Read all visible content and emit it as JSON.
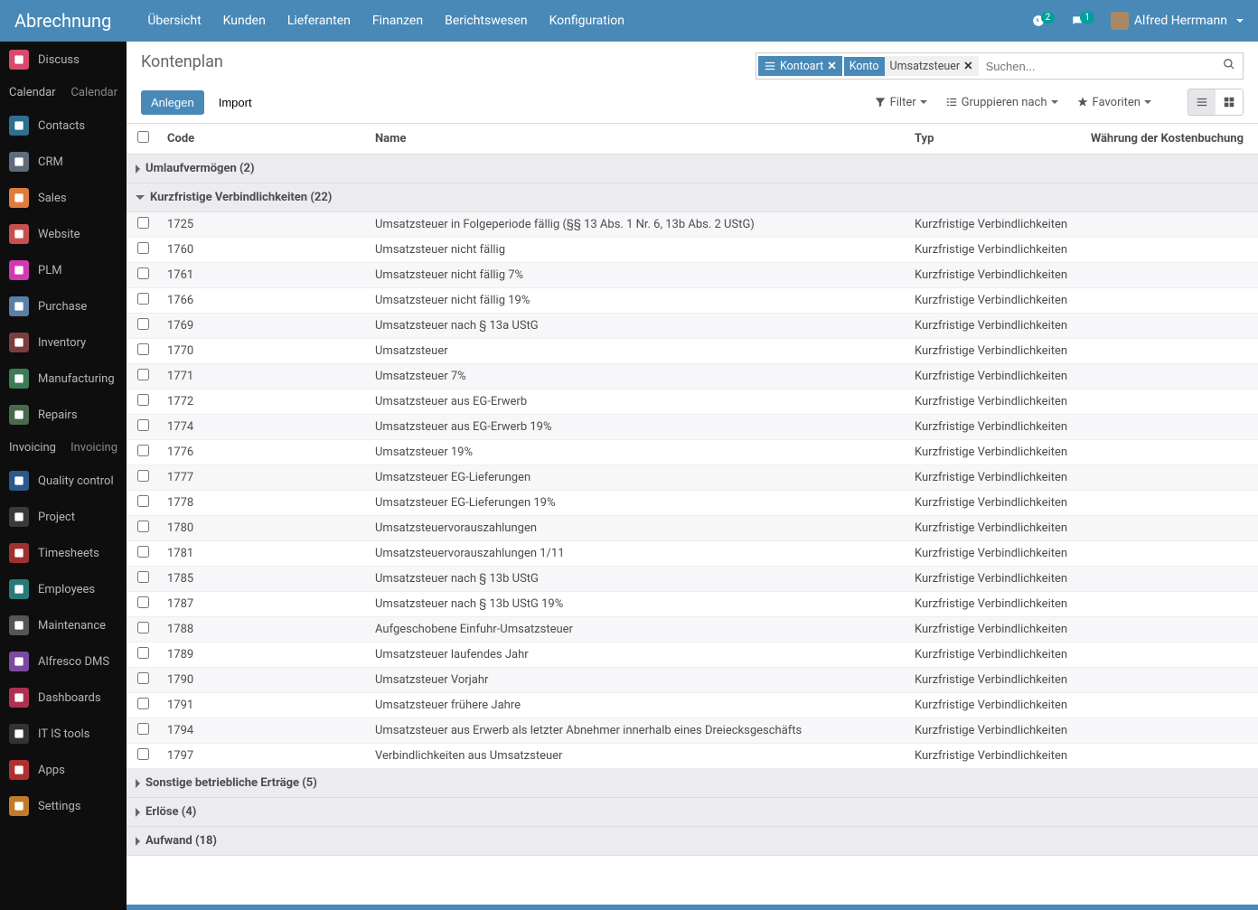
{
  "brand": "Abrechnung",
  "main_menu": [
    "Übersicht",
    "Kunden",
    "Lieferanten",
    "Finanzen",
    "Berichtswesen",
    "Konfiguration"
  ],
  "activity_badge": "2",
  "chat_badge": "1",
  "user_name": "Alfred Herrmann",
  "sidebar": [
    {
      "label": "Discuss",
      "bg": "#d84a6b",
      "icon": "chat"
    },
    {
      "label": "Calendar",
      "text2": "Calendar",
      "textonly": true
    },
    {
      "label": "Contacts",
      "bg": "#2f6f8f",
      "icon": "contacts"
    },
    {
      "label": "CRM",
      "bg": "#5e6b7a",
      "icon": "crm"
    },
    {
      "label": "Sales",
      "bg": "#e07b3c",
      "icon": "sales"
    },
    {
      "label": "Website",
      "bg": "#c94f4f",
      "icon": "globe"
    },
    {
      "label": "PLM",
      "bg": "#d13ab3",
      "icon": "plm"
    },
    {
      "label": "Purchase",
      "bg": "#5b7fa6",
      "icon": "card"
    },
    {
      "label": "Inventory",
      "bg": "#7a3e3e",
      "icon": "box"
    },
    {
      "label": "Manufacturing",
      "bg": "#3e7a55",
      "icon": "wrench"
    },
    {
      "label": "Repairs",
      "bg": "#4a6a4a",
      "icon": "repair"
    },
    {
      "label": "Invoicing",
      "text2": "Invoicing",
      "textonly": true
    },
    {
      "label": "Quality control",
      "bg": "#2b5a8a",
      "icon": "badge"
    },
    {
      "label": "Project",
      "bg": "#3a3a3a",
      "icon": "project"
    },
    {
      "label": "Timesheets",
      "bg": "#a03030",
      "icon": "clock"
    },
    {
      "label": "Employees",
      "bg": "#2a7a7a",
      "icon": "people"
    },
    {
      "label": "Maintenance",
      "bg": "#555",
      "icon": "tools"
    },
    {
      "label": "Alfresco DMS",
      "bg": "#7a4aa0",
      "icon": "dms"
    },
    {
      "label": "Dashboards",
      "bg": "#b03050",
      "icon": "dash"
    },
    {
      "label": "IT IS tools",
      "bg": "#333",
      "icon": "gear"
    },
    {
      "label": "Apps",
      "bg": "#b03030",
      "icon": "apps"
    },
    {
      "label": "Settings",
      "bg": "#c07b2b",
      "icon": "settings"
    }
  ],
  "page_title": "Kontenplan",
  "btn_create": "Anlegen",
  "btn_import": "Import",
  "search": {
    "facet1_label": "Kontoart",
    "facet2_label": "Konto",
    "facet2_value": "Umsatzsteuer",
    "placeholder": "Suchen..."
  },
  "filter_label": "Filter",
  "group_label": "Gruppieren nach",
  "fav_label": "Favoriten",
  "columns": {
    "code": "Code",
    "name": "Name",
    "type": "Typ",
    "currency": "Währung der Kostenbuchung"
  },
  "groups": [
    {
      "label": "Umlaufvermögen",
      "count": 2,
      "open": false,
      "rows": []
    },
    {
      "label": "Kurzfristige Verbindlichkeiten",
      "count": 22,
      "open": true,
      "rows": [
        {
          "code": "1725",
          "name": "Umsatzsteuer in Folgeperiode fällig (§§ 13 Abs. 1 Nr. 6, 13b Abs. 2 UStG)",
          "type": "Kurzfristige Verbindlichkeiten"
        },
        {
          "code": "1760",
          "name": "Umsatzsteuer nicht fällig",
          "type": "Kurzfristige Verbindlichkeiten"
        },
        {
          "code": "1761",
          "name": "Umsatzsteuer nicht fällig 7%",
          "type": "Kurzfristige Verbindlichkeiten"
        },
        {
          "code": "1766",
          "name": "Umsatzsteuer nicht fällig 19%",
          "type": "Kurzfristige Verbindlichkeiten"
        },
        {
          "code": "1769",
          "name": "Umsatzsteuer nach § 13a UStG",
          "type": "Kurzfristige Verbindlichkeiten"
        },
        {
          "code": "1770",
          "name": "Umsatzsteuer",
          "type": "Kurzfristige Verbindlichkeiten"
        },
        {
          "code": "1771",
          "name": "Umsatzsteuer 7%",
          "type": "Kurzfristige Verbindlichkeiten"
        },
        {
          "code": "1772",
          "name": "Umsatzsteuer aus EG-Erwerb",
          "type": "Kurzfristige Verbindlichkeiten"
        },
        {
          "code": "1774",
          "name": "Umsatzsteuer aus EG-Erwerb 19%",
          "type": "Kurzfristige Verbindlichkeiten"
        },
        {
          "code": "1776",
          "name": "Umsatzsteuer 19%",
          "type": "Kurzfristige Verbindlichkeiten"
        },
        {
          "code": "1777",
          "name": "Umsatzsteuer EG-Lieferungen",
          "type": "Kurzfristige Verbindlichkeiten"
        },
        {
          "code": "1778",
          "name": "Umsatzsteuer EG-Lieferungen 19%",
          "type": "Kurzfristige Verbindlichkeiten"
        },
        {
          "code": "1780",
          "name": "Umsatzsteuervorauszahlungen",
          "type": "Kurzfristige Verbindlichkeiten"
        },
        {
          "code": "1781",
          "name": "Umsatzsteuervorauszahlungen 1/11",
          "type": "Kurzfristige Verbindlichkeiten"
        },
        {
          "code": "1785",
          "name": "Umsatzsteuer nach § 13b UStG",
          "type": "Kurzfristige Verbindlichkeiten"
        },
        {
          "code": "1787",
          "name": "Umsatzsteuer nach § 13b UStG 19%",
          "type": "Kurzfristige Verbindlichkeiten"
        },
        {
          "code": "1788",
          "name": "Aufgeschobene Einfuhr-Umsatzsteuer",
          "type": "Kurzfristige Verbindlichkeiten"
        },
        {
          "code": "1789",
          "name": "Umsatzsteuer laufendes Jahr",
          "type": "Kurzfristige Verbindlichkeiten"
        },
        {
          "code": "1790",
          "name": "Umsatzsteuer Vorjahr",
          "type": "Kurzfristige Verbindlichkeiten"
        },
        {
          "code": "1791",
          "name": "Umsatzsteuer frühere Jahre",
          "type": "Kurzfristige Verbindlichkeiten"
        },
        {
          "code": "1794",
          "name": "Umsatzsteuer aus Erwerb als letzter Abnehmer innerhalb eines Dreiecksgeschäfts",
          "type": "Kurzfristige Verbindlichkeiten"
        },
        {
          "code": "1797",
          "name": "Verbindlichkeiten aus Umsatzsteuer",
          "type": "Kurzfristige Verbindlichkeiten"
        }
      ]
    },
    {
      "label": "Sonstige betriebliche Erträge",
      "count": 5,
      "open": false,
      "rows": []
    },
    {
      "label": "Erlöse",
      "count": 4,
      "open": false,
      "rows": []
    },
    {
      "label": "Aufwand",
      "count": 18,
      "open": false,
      "rows": []
    }
  ]
}
